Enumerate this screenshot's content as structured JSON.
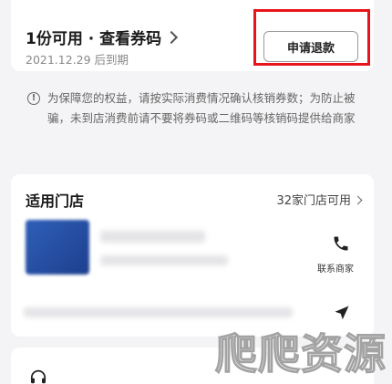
{
  "voucher": {
    "title": "1份可用 · 查看券码",
    "expiry": "2021.12.29 后到期",
    "refund_label": "申请退款"
  },
  "notice": {
    "text": "为保障您的权益，请按实际消费情况确认核销券数；为防止被骗，未到店消费前请不要将券码或二维码等核销码提供给商家"
  },
  "stores_section": {
    "title": "适用门店",
    "count_label": "32家门店可用",
    "contact_label": "联系商家"
  },
  "watermark": "爬爬资源",
  "icons": [
    "info-icon",
    "chevron-right-icon",
    "phone-icon",
    "navigation-arrow-icon",
    "headphones-icon"
  ],
  "colors": {
    "highlight": "#e8141b",
    "store_thumb": "#2f5fb8"
  }
}
